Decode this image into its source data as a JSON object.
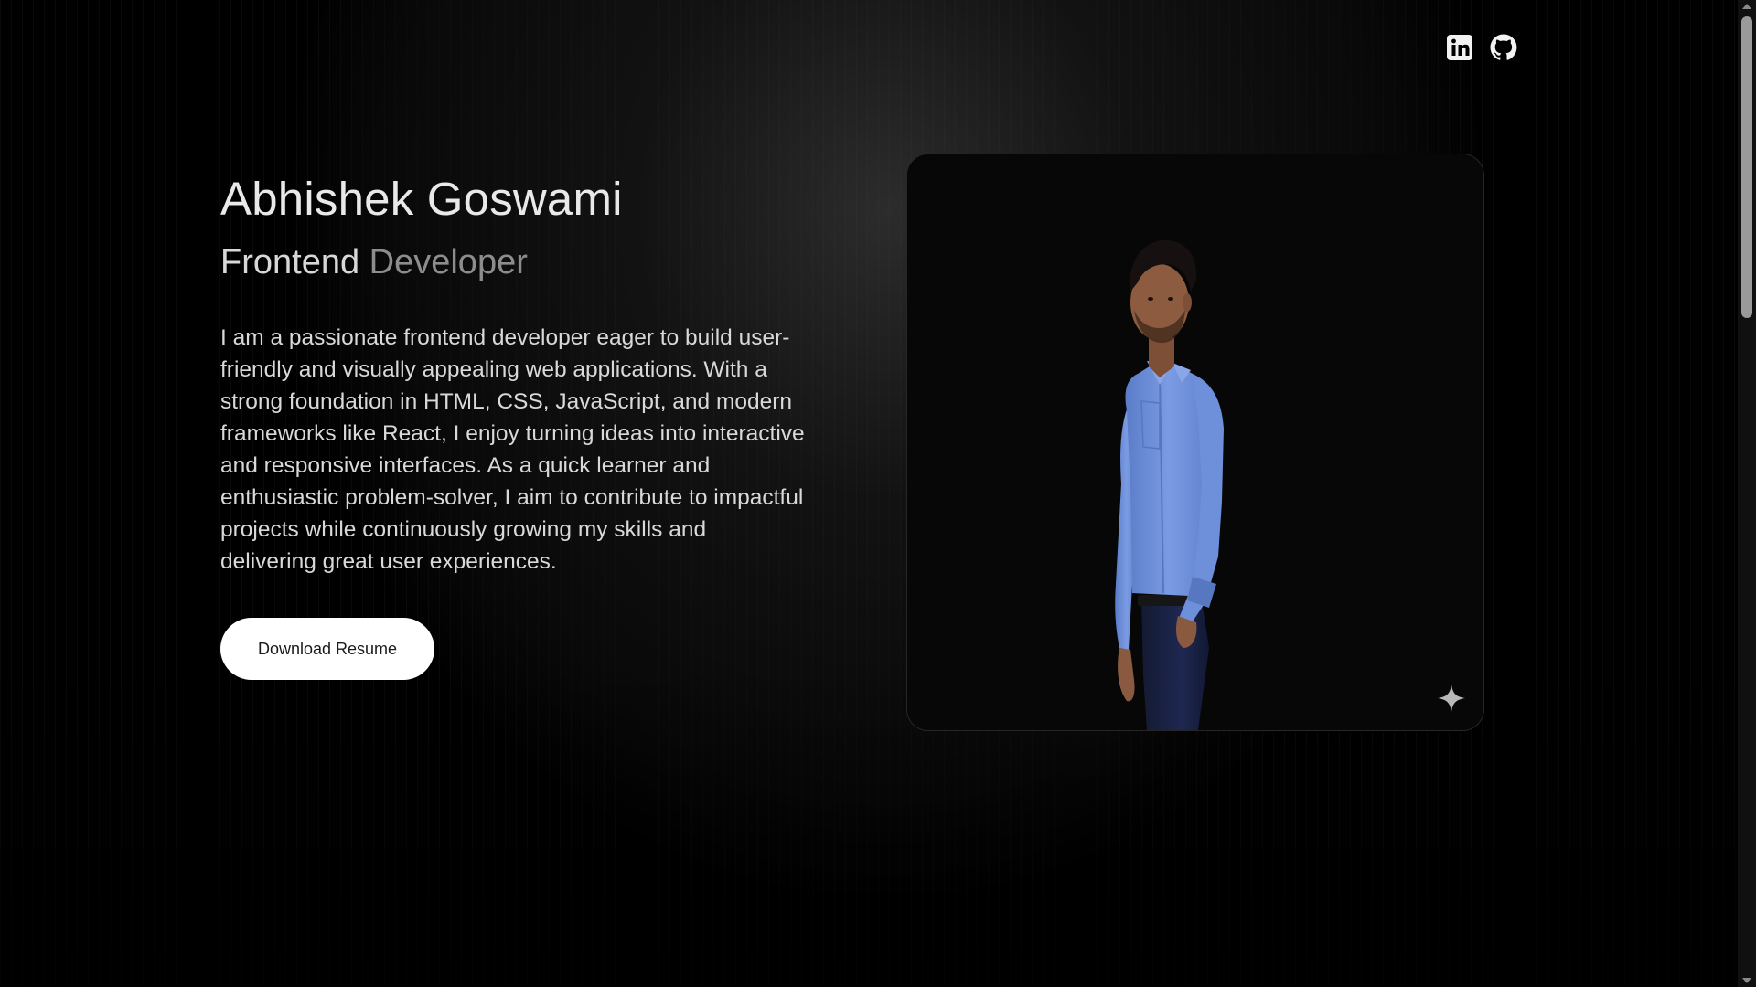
{
  "social": {
    "linkedin_label": "LinkedIn",
    "github_label": "GitHub"
  },
  "hero": {
    "name": "Abhishek Goswami",
    "role_part1": "Frontend",
    "role_part2": "Developer",
    "bio": "I am a passionate frontend developer eager to build user-friendly and visually appealing web applications. With a strong foundation in HTML, CSS, JavaScript, and modern frameworks like React, I enjoy turning ideas into interactive and responsive interfaces. As a quick learner and enthusiastic problem-solver, I aim to contribute to impactful projects while continuously growing my skills and delivering great user experiences.",
    "resume_button": "Download Resume"
  },
  "icons": {
    "linkedin": "linkedin-icon",
    "github": "github-icon",
    "sparkle": "sparkle-icon"
  },
  "colors": {
    "background": "#000000",
    "button_bg": "#ffffff",
    "button_text": "#1a1a1a",
    "name_text": "#e9e9e9",
    "role_secondary": "#8d8d8d",
    "shirt": "#6f93df"
  },
  "scroll": {
    "position_fraction": 0.0
  }
}
